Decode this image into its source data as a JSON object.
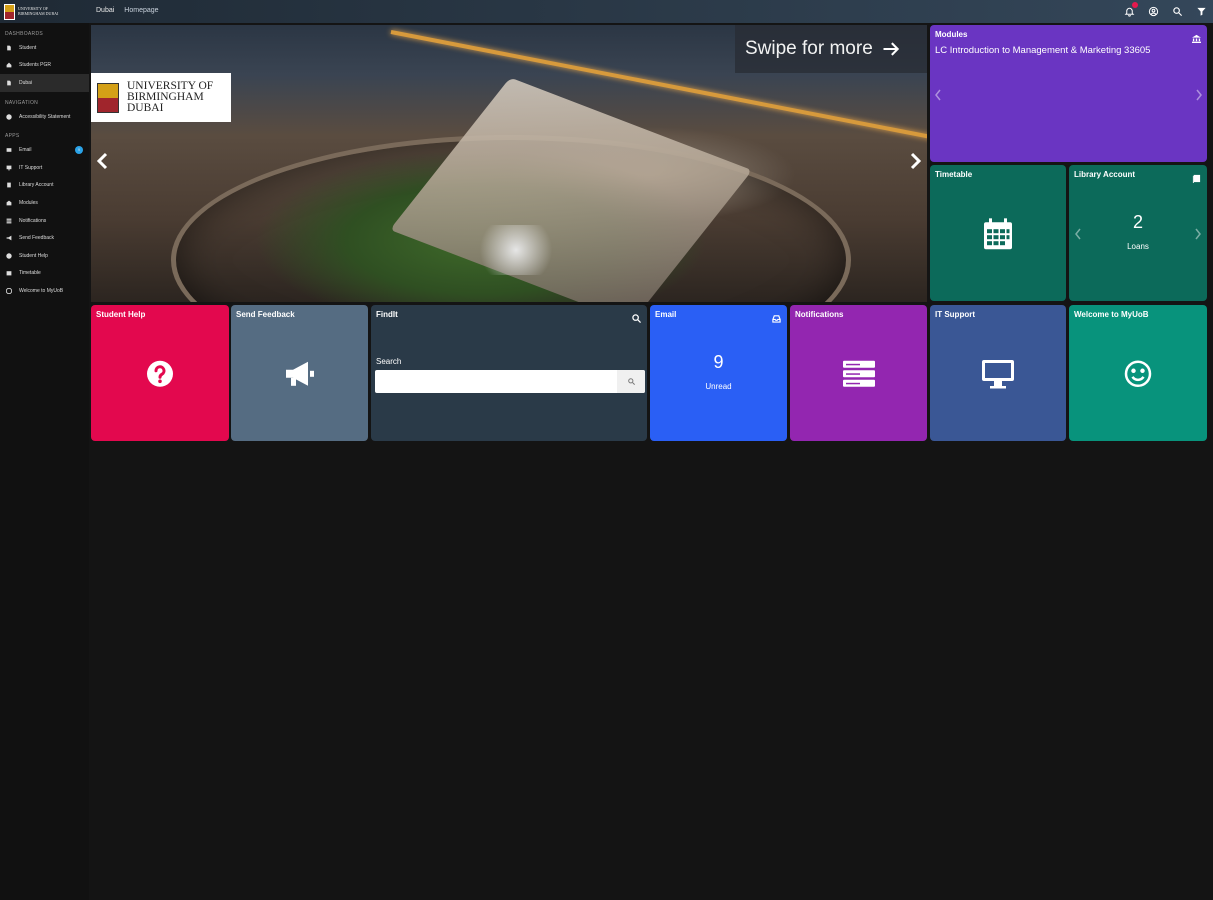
{
  "header": {
    "brand_text": "UNIVERSITY OF BIRMINGHAM DUBAI",
    "breadcrumbs": [
      "Dubai",
      "Homepage"
    ]
  },
  "sidebar": {
    "sections": [
      {
        "heading": "DASHBOARDS",
        "items": [
          {
            "label": "Student",
            "icon": "document-icon"
          },
          {
            "label": "Students PGR",
            "icon": "home-icon"
          },
          {
            "label": "Dubai",
            "icon": "document-icon",
            "active": true
          }
        ]
      },
      {
        "heading": "NAVIGATION",
        "items": [
          {
            "label": "Accessibility Statement",
            "icon": "info-icon"
          }
        ]
      },
      {
        "heading": "APPS",
        "items": [
          {
            "label": "Email",
            "icon": "mail-icon",
            "badge": "9"
          },
          {
            "label": "IT Support",
            "icon": "monitor-icon"
          },
          {
            "label": "Library Account",
            "icon": "book-icon"
          },
          {
            "label": "Modules",
            "icon": "building-icon"
          },
          {
            "label": "Notifications",
            "icon": "list-icon"
          },
          {
            "label": "Send Feedback",
            "icon": "megaphone-icon"
          },
          {
            "label": "Student Help",
            "icon": "question-icon"
          },
          {
            "label": "Timetable",
            "icon": "calendar-icon"
          },
          {
            "label": "Welcome to MyUoB",
            "icon": "smile-icon"
          }
        ]
      }
    ]
  },
  "hero": {
    "swipe_text": "Swipe for more",
    "logo_line1": "UNIVERSITY OF",
    "logo_line2": "BIRMINGHAM",
    "logo_line3": "DUBAI"
  },
  "tiles": {
    "modules": {
      "title": "Modules",
      "line": "LC Introduction to Management & Marketing 33605",
      "color": "#6a35c2"
    },
    "timetable": {
      "title": "Timetable",
      "color": "#0c6a5a"
    },
    "library": {
      "title": "Library Account",
      "count": "2",
      "unit": "Loans",
      "color": "#0c6a5a"
    },
    "student_help": {
      "title": "Student Help",
      "color": "#e3084e"
    },
    "send_feedback": {
      "title": "Send Feedback",
      "color": "#556c82"
    },
    "findit": {
      "title": "FindIt",
      "search_label": "Search",
      "placeholder": "",
      "color": "#2a3a48"
    },
    "email": {
      "title": "Email",
      "count": "9",
      "unit": "Unread",
      "color": "#2a5ff5"
    },
    "notifications": {
      "title": "Notifications",
      "color": "#9326b0"
    },
    "it_support": {
      "title": "IT Support",
      "color": "#3a5795"
    },
    "welcome": {
      "title": "Welcome to MyUoB",
      "color": "#08937c"
    }
  }
}
